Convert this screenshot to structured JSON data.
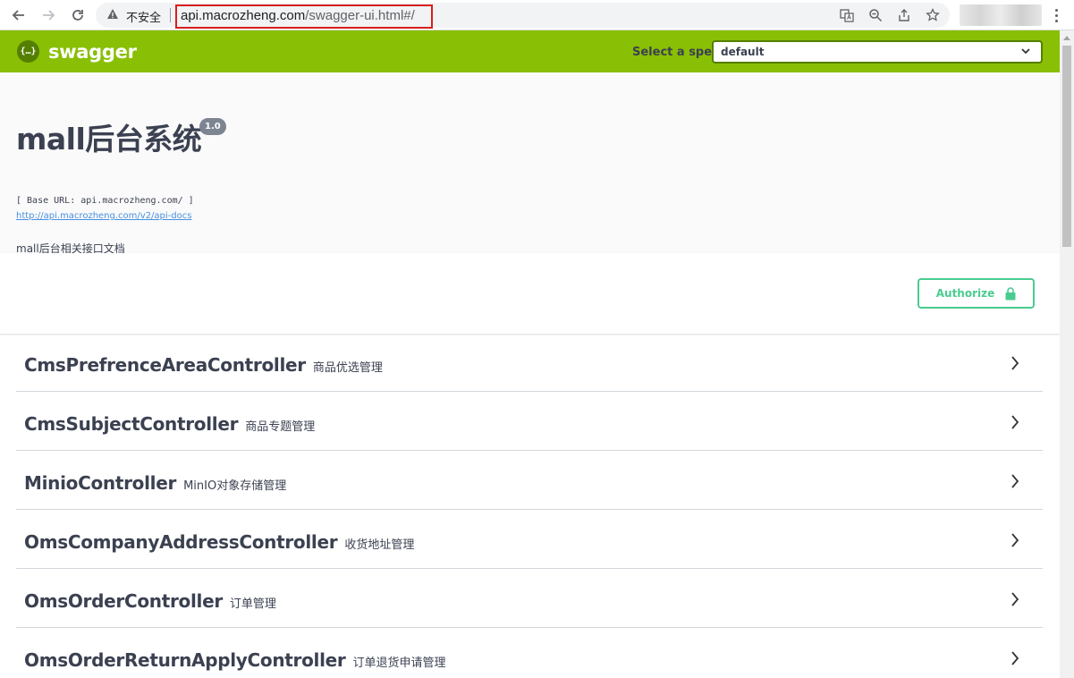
{
  "browser": {
    "insecure_label": "不安全",
    "url_host": "api.macrozheng.com",
    "url_path": "/swagger-ui.html#/"
  },
  "topbar": {
    "logo_symbol": "{…}",
    "logo_text": "swagger",
    "spec_label": "Select a spec",
    "spec_value": "default"
  },
  "info": {
    "title": "mall后台系统",
    "version": "1.0",
    "base_url": "[ Base URL: api.macrozheng.com/ ]",
    "docs_link": "http://api.macrozheng.com/v2/api-docs",
    "description": "mall后台相关接口文档"
  },
  "scheme": {
    "authorize_label": "Authorize"
  },
  "tags": [
    {
      "name": "CmsPrefrenceAreaController",
      "description": "商品优选管理"
    },
    {
      "name": "CmsSubjectController",
      "description": "商品专题管理"
    },
    {
      "name": "MinioController",
      "description": "MinIO对象存储管理"
    },
    {
      "name": "OmsCompanyAddressController",
      "description": "收货地址管理"
    },
    {
      "name": "OmsOrderController",
      "description": "订单管理"
    },
    {
      "name": "OmsOrderReturnApplyController",
      "description": "订单退货申请管理"
    }
  ],
  "colors": {
    "topbar": "#89bf04",
    "authorize": "#49cc90",
    "url_highlight_border": "#d81e1e"
  }
}
